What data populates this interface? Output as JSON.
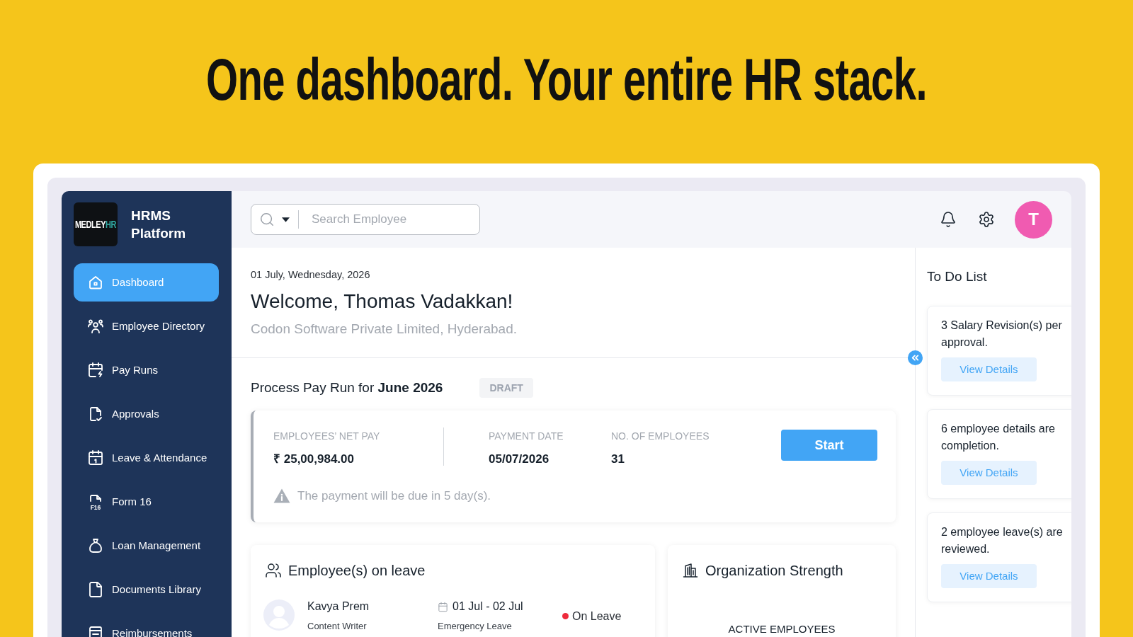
{
  "headline": "One dashboard. Your entire HR stack.",
  "sidebar": {
    "logo": {
      "text": "MEDLEY",
      "accent": "HR"
    },
    "title": "HRMS Platform",
    "items": [
      {
        "label": "Dashboard",
        "selected": true
      },
      {
        "label": "Employee Directory",
        "selected": false
      },
      {
        "label": "Pay Runs",
        "selected": false
      },
      {
        "label": "Approvals",
        "selected": false
      },
      {
        "label": "Leave & Attendance",
        "selected": false
      },
      {
        "label": "Form 16",
        "selected": false,
        "icon_label": "F16"
      },
      {
        "label": "Loan Management",
        "selected": false
      },
      {
        "label": "Documents Library",
        "selected": false
      },
      {
        "label": "Reimbursements",
        "selected": false
      }
    ]
  },
  "topbar": {
    "search": {
      "placeholder": "Search Employee"
    },
    "avatar": "T"
  },
  "welcome": {
    "date": "01 July, Wednesday, 2026",
    "greeting": "Welcome, Thomas Vadakkan!",
    "company": "Codon Software Private Limited, Hyderabad."
  },
  "pay_run": {
    "title": "Process Pay Run for **June 2026**",
    "status": "DRAFT",
    "fields": [
      {
        "label": "EMPLOYEES’ NET PAY",
        "value": "₹ 25,00,984.00"
      },
      {
        "label": "PAYMENT DATE",
        "value": "05/07/2026"
      },
      {
        "label": "NO. OF EMPLOYEES",
        "value": "31"
      }
    ],
    "button": "Start",
    "note": "The payment will be due in 5 day(s)."
  },
  "leave_card": {
    "title": "Employee(s) on leave",
    "employees": [
      {
        "name": "Kavya Prem",
        "role": "Content Writer",
        "dates": "01 Jul - 02 Jul",
        "leave_type": "Emergency Leave",
        "status": "On Leave",
        "color": "#ee2a3c"
      }
    ]
  },
  "org_card": {
    "title": "Organization Strength",
    "label": "ACTIVE EMPLOYEES"
  },
  "todo": {
    "title": "To Do List",
    "items": [
      {
        "lines": [
          "3 Salary Revision(s) per",
          "approval."
        ],
        "button": "View Details"
      },
      {
        "lines": [
          "6 employee details are",
          "completion."
        ],
        "button": "View Details"
      },
      {
        "lines": [
          "2 employee leave(s) are",
          "reviewed."
        ],
        "button": "View Details"
      }
    ]
  }
}
